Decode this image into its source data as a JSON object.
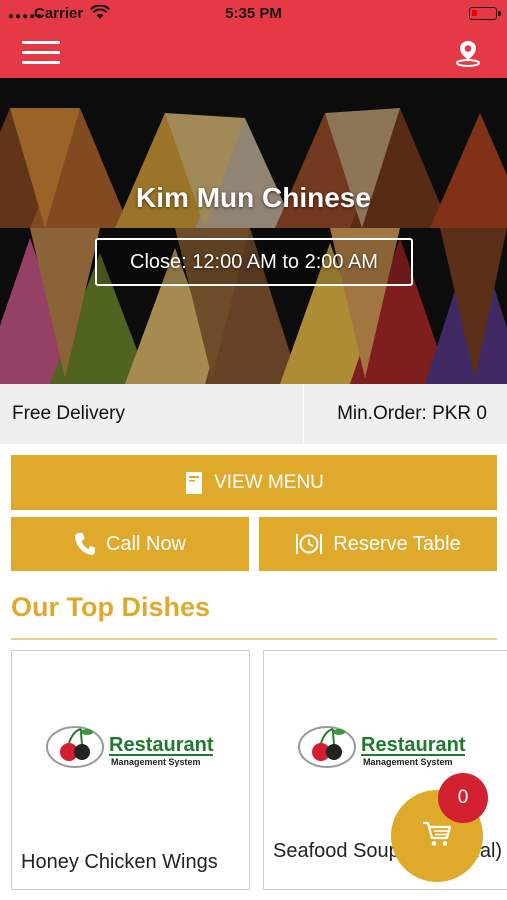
{
  "status_bar": {
    "carrier": "Carrier",
    "time": "5:35 PM"
  },
  "navbar": {
    "menu_icon": "hamburger-menu-icon",
    "location_icon": "location-pin-icon",
    "bar_color": "#e63946"
  },
  "hero": {
    "restaurant_name": "Kim Mun Chinese",
    "hours": "Close: 12:00 AM to 2:00 AM"
  },
  "info": {
    "delivery": "Free Delivery",
    "min_order": "Min.Order: PKR 0"
  },
  "actions": {
    "view_menu": "VIEW MENU",
    "call_now": "Call Now",
    "reserve_table": "Reserve Table",
    "accent_color": "#dfa92b"
  },
  "top_dishes": {
    "title": "Our Top Dishes",
    "logo_text": {
      "name": "Restaurant",
      "sub": "Management System"
    },
    "items": [
      {
        "name": "Honey Chicken Wings"
      },
      {
        "name": "Seafood Soup (Seasonal)"
      }
    ]
  },
  "cart": {
    "count": "0",
    "icon": "shopping-cart-icon",
    "badge_color": "#d3202f"
  }
}
